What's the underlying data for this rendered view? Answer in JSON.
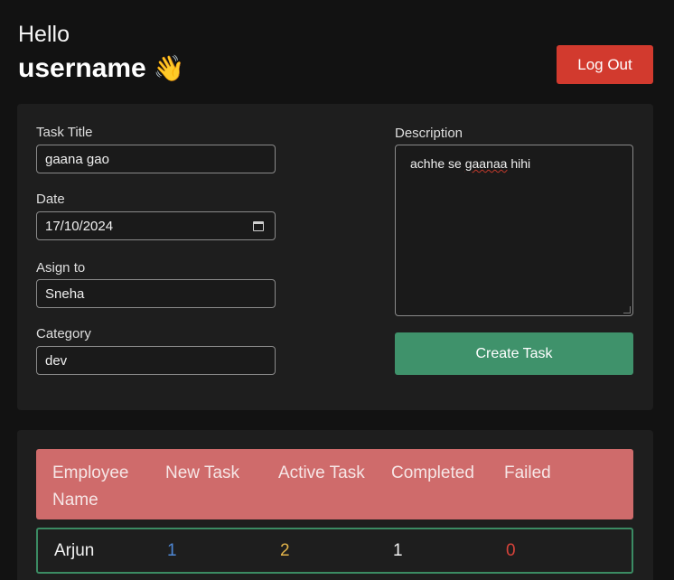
{
  "header": {
    "greeting": "Hello",
    "username": "username",
    "wave_emoji": "👋",
    "logout_label": "Log Out"
  },
  "form": {
    "task_title_label": "Task Title",
    "task_title_value": "gaana gao",
    "date_label": "Date",
    "date_value": "17/10/2024",
    "assign_label": "Asign to",
    "assign_value": "Sneha",
    "category_label": "Category",
    "category_value": "dev",
    "description_label": "Description",
    "description_words": [
      "achhe",
      "se",
      "gaanaa",
      "hihi"
    ],
    "create_label": "Create Task"
  },
  "table": {
    "headers": [
      "Employee Name",
      "New Task",
      "Active Task",
      "Completed",
      "Failed"
    ],
    "header_name_line1": "Employee",
    "header_name_line2": "Name",
    "rows": [
      {
        "name": "Arjun",
        "new_task": "1",
        "active_task": "2",
        "completed": "1",
        "failed": "0"
      }
    ]
  },
  "colors": {
    "logout": "#d23a2e",
    "create": "#3f926b",
    "table_header": "#cf6b6b",
    "row_border": "#3b8b63",
    "new_task": "#4f88d6",
    "active_task": "#e1b34a",
    "completed": "#f2f2f2",
    "failed": "#d6433a"
  }
}
